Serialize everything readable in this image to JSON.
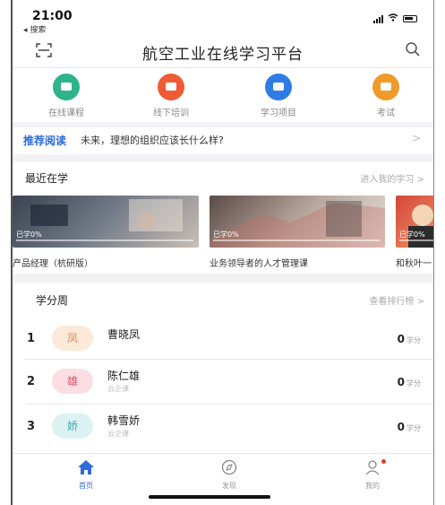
{
  "status_bar": {
    "time": "21:00",
    "back_label": "◂ 搜索"
  },
  "header": {
    "title": "航空工业在线学习平台"
  },
  "quick_entries": [
    {
      "label": "在线课程",
      "color": "#2fb38a"
    },
    {
      "label": "线下培训",
      "color": "#ef5a35"
    },
    {
      "label": "学习项目",
      "color": "#2f7be6"
    },
    {
      "label": "考试",
      "color": "#f09a2c"
    }
  ],
  "recommend": {
    "tag": "推荐阅读",
    "text": "未来，理想的组织应该长什么样?",
    "arrow": ">"
  },
  "recent": {
    "title": "最近在学",
    "link": "进入我的学习 >",
    "courses": [
      {
        "title": "产品经理（杭研版）",
        "progress_label": "已学0%",
        "progress": 0
      },
      {
        "title": "业务领导者的人才管理课",
        "progress_label": "已学0%",
        "progress": 0
      },
      {
        "title": "和秋叶一",
        "progress_label": "已学0%",
        "progress": 0
      }
    ]
  },
  "leaderboard": {
    "title": "学分周",
    "link": "查看排行榜 >",
    "entries": [
      {
        "rank": "1",
        "avatar_char": "凤",
        "name": "曹晓凤",
        "dept": "",
        "score": "0",
        "unit": "学分",
        "avatar_bg": "#fde9d9",
        "avatar_fg": "#e08a52"
      },
      {
        "rank": "2",
        "avatar_char": "雄",
        "name": "陈仁雄",
        "dept": "云企课",
        "score": "0",
        "unit": "学分",
        "avatar_bg": "#fbdde2",
        "avatar_fg": "#e0556b"
      },
      {
        "rank": "3",
        "avatar_char": "娇",
        "name": "韩雪娇",
        "dept": "云企课",
        "score": "0",
        "unit": "学分",
        "avatar_bg": "#dcf1f2",
        "avatar_fg": "#3aa9b0"
      }
    ]
  },
  "tabbar": {
    "items": [
      {
        "label": "首页",
        "icon": "home-icon",
        "active": true
      },
      {
        "label": "发现",
        "icon": "compass-icon",
        "active": false
      },
      {
        "label": "我的",
        "icon": "user-icon",
        "active": false
      }
    ]
  },
  "colors": {
    "accent": "#2d6bd8",
    "badge": "#e53935"
  }
}
